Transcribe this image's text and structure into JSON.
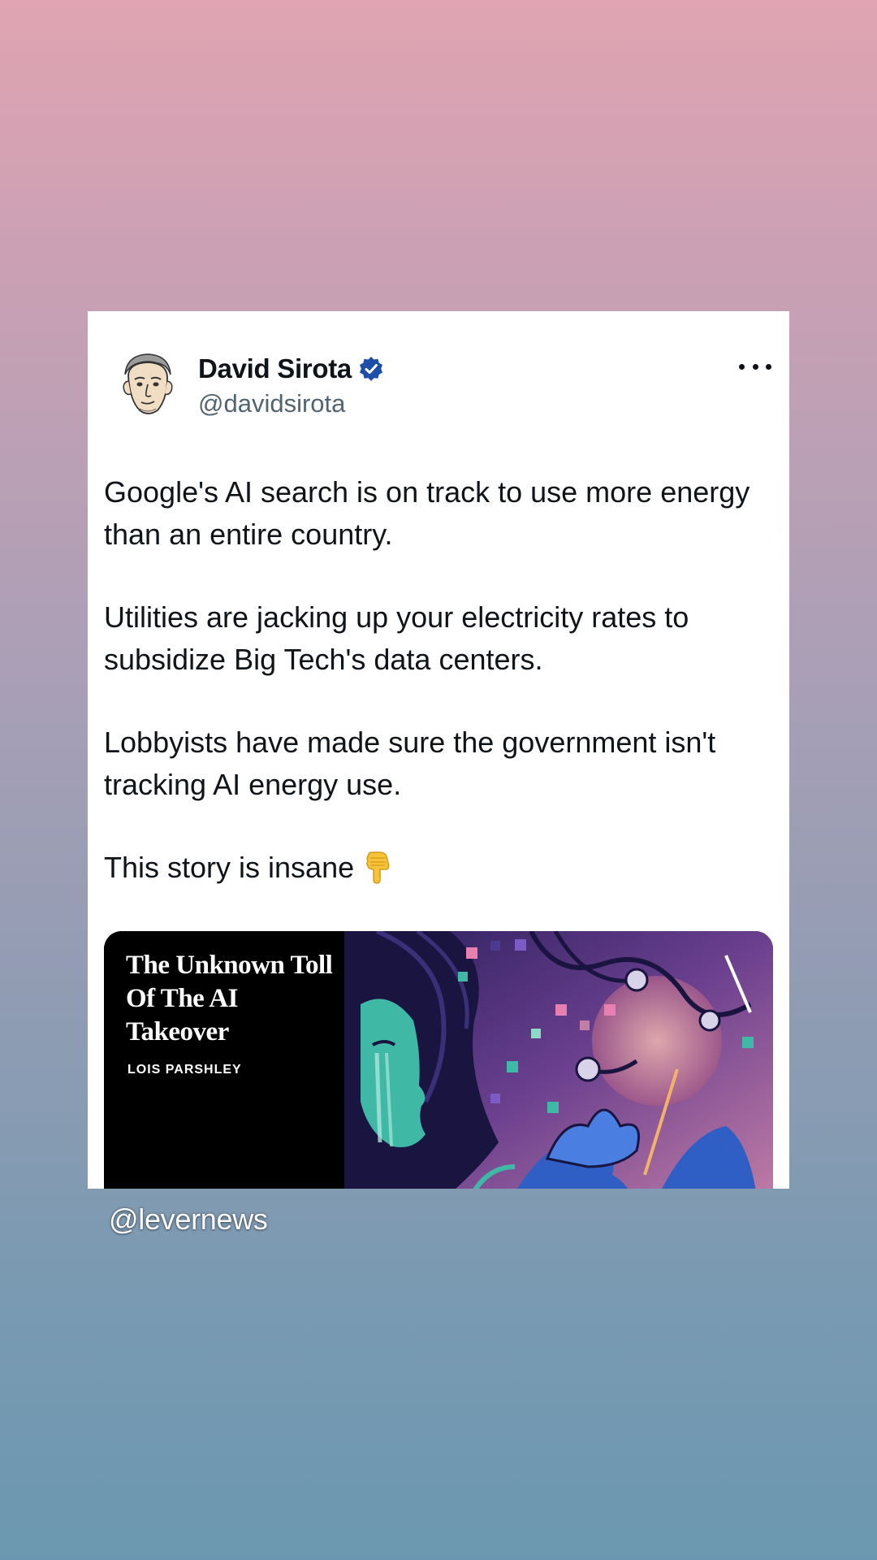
{
  "tweet": {
    "author_name": "David Sirota",
    "author_handle": "@davidsirota",
    "verified": true,
    "paragraphs": [
      "Google's AI search is on track to use more energy than an entire country.",
      "Utilities are jacking up your electricity rates to subsidize Big Tech's data centers.",
      "Lobbyists have made sure the government isn't tracking AI energy use.",
      "This story is insane"
    ],
    "emoji": "backhand-index-pointing-down"
  },
  "link_card": {
    "title": "The Unknown Toll Of The AI Takeover",
    "author": "LOIS PARSHLEY"
  },
  "icons": {
    "avatar": "caricature-avatar",
    "verified": "verified-badge-icon",
    "more": "more-options-icon"
  },
  "colors": {
    "verified_badge": "#1d4fa8",
    "text_primary": "#0f1419",
    "text_secondary": "#536471"
  },
  "watermark": "@levernews"
}
